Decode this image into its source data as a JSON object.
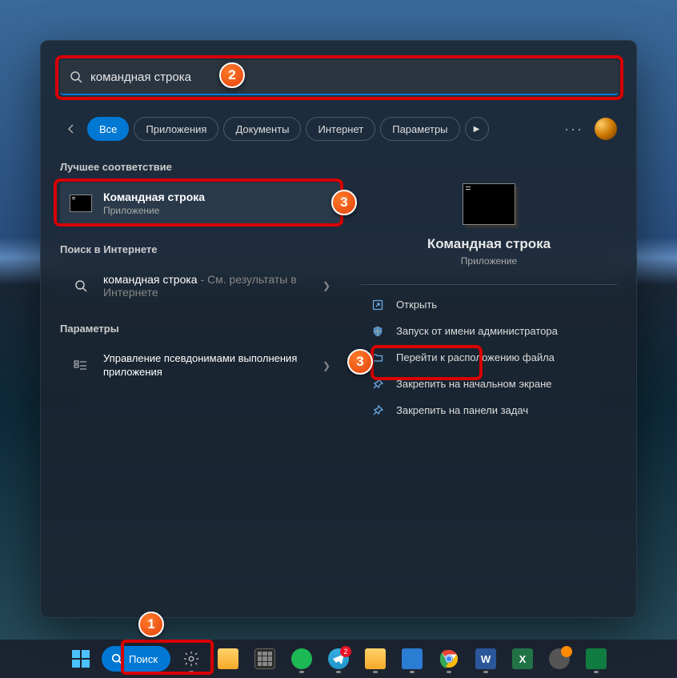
{
  "search": {
    "query": "командная строка"
  },
  "filters": {
    "items": [
      "Все",
      "Приложения",
      "Документы",
      "Интернет",
      "Параметры"
    ],
    "active_index": 0
  },
  "left": {
    "best_match_label": "Лучшее соответствие",
    "best": {
      "title": "Командная строка",
      "subtitle": "Приложение"
    },
    "web_search_label": "Поиск в Интернете",
    "web": {
      "query": "командная строка",
      "suffix": " - См. результаты в Интернете"
    },
    "settings_label": "Параметры",
    "settings_item": "Управление псевдонимами выполнения приложения"
  },
  "preview": {
    "title": "Командная строка",
    "subtitle": "Приложение",
    "actions": {
      "open": "Открыть",
      "run_admin": "Запуск от имени администратора",
      "file_location": "Перейти к расположению файла",
      "pin_start": "Закрепить на начальном экране",
      "pin_taskbar": "Закрепить на панели задач"
    }
  },
  "taskbar": {
    "search_label": "Поиск",
    "telegram_badge": "2"
  },
  "annotations": {
    "a1": "1",
    "a2": "2",
    "a3": "3",
    "a3b": "3"
  }
}
